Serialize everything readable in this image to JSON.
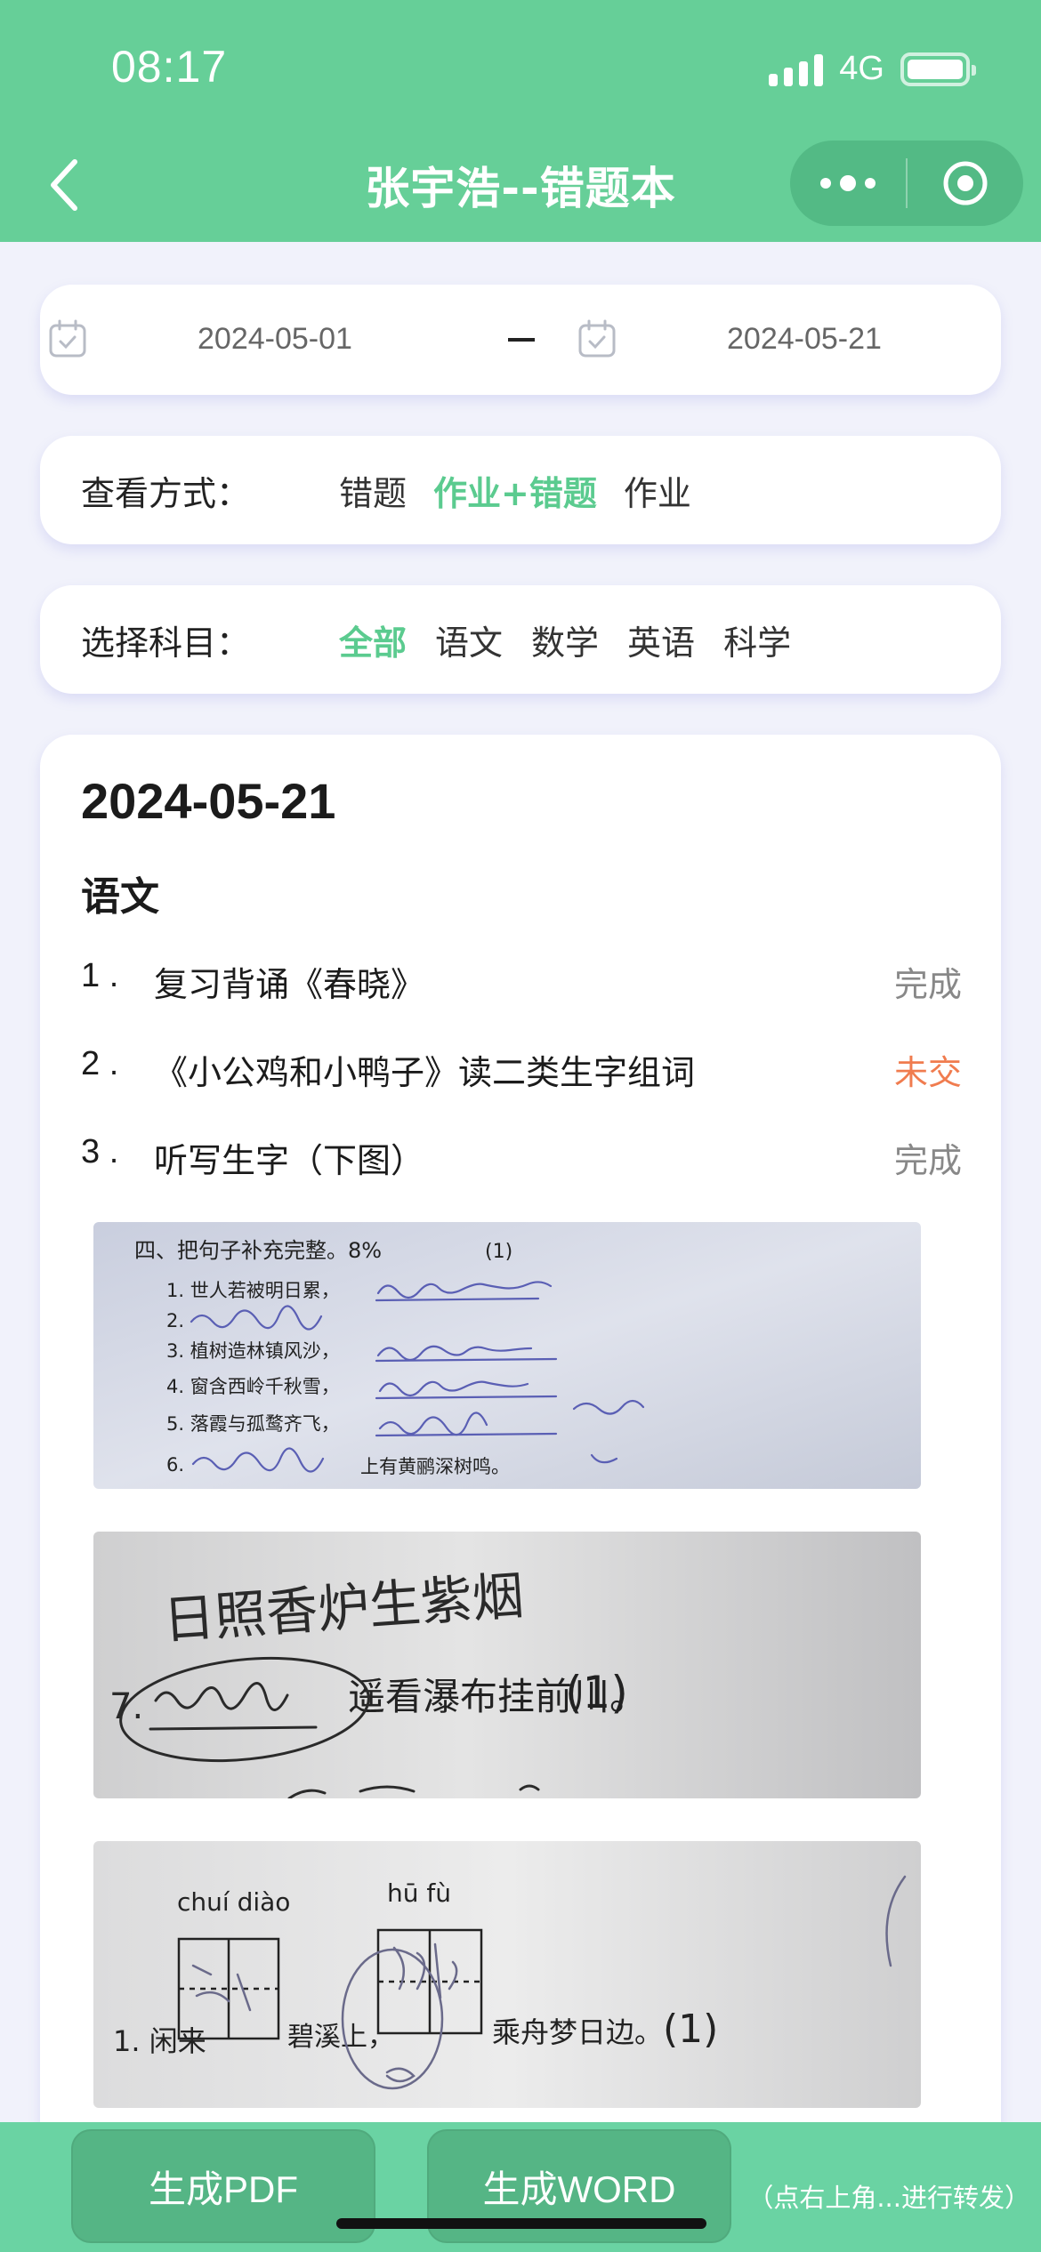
{
  "status_bar": {
    "time": "08:17",
    "network": "4G"
  },
  "nav": {
    "title": "张宇浩--错题本"
  },
  "date_range": {
    "start": "2024-05-01",
    "separator": "–",
    "end": "2024-05-21"
  },
  "view_mode": {
    "label": "查看方式：",
    "options": [
      {
        "label": "错题",
        "active": false
      },
      {
        "label": "作业+错题",
        "active": true
      },
      {
        "label": "作业",
        "active": false
      }
    ]
  },
  "subject_filter": {
    "label": "选择科目：",
    "options": [
      {
        "label": "全部",
        "active": true
      },
      {
        "label": "语文",
        "active": false
      },
      {
        "label": "数学",
        "active": false
      },
      {
        "label": "英语",
        "active": false
      },
      {
        "label": "科学",
        "active": false
      }
    ]
  },
  "record": {
    "date": "2024-05-21",
    "subject": "语文",
    "tasks": [
      {
        "num": "1 .",
        "text": "复习背诵《春晓》",
        "status": "完成",
        "status_color": "#888888"
      },
      {
        "num": "2 .",
        "text": "《小公鸡和小鸭子》读二类生字组词",
        "status": "未交",
        "status_color": "#f07c4f"
      },
      {
        "num": "3 .",
        "text": "听写生字（下图）",
        "status": "完成",
        "status_color": "#888888"
      }
    ],
    "photos": [
      {
        "heading": "四、把句子补充完整。8%",
        "lines": [
          "1. 世人若被明日累，",
          "2.",
          "3. 植树造林镇风沙，",
          "4. 窗含西岭千秋雪，",
          "5. 落霞与孤鹜齐飞，",
          "6."
        ],
        "tail": "上有黄鹂深树鸣。"
      },
      {
        "lines": [
          "日照香炉生紫烟",
          "7.",
          "遥看瀑布挂前川。"
        ]
      },
      {
        "pinyin": [
          "chuí diào",
          "hū fù"
        ],
        "lines": [
          "1. 闲来",
          "碧溪上，",
          "乘舟梦日边。"
        ]
      }
    ]
  },
  "actions": {
    "pdf_label": "生成PDF",
    "word_label": "生成WORD",
    "hint": "（点右上角...进行转发）"
  },
  "colors": {
    "primary": "#66cf98",
    "accent_text": "#5bcb8f",
    "pending": "#f07c4f"
  }
}
